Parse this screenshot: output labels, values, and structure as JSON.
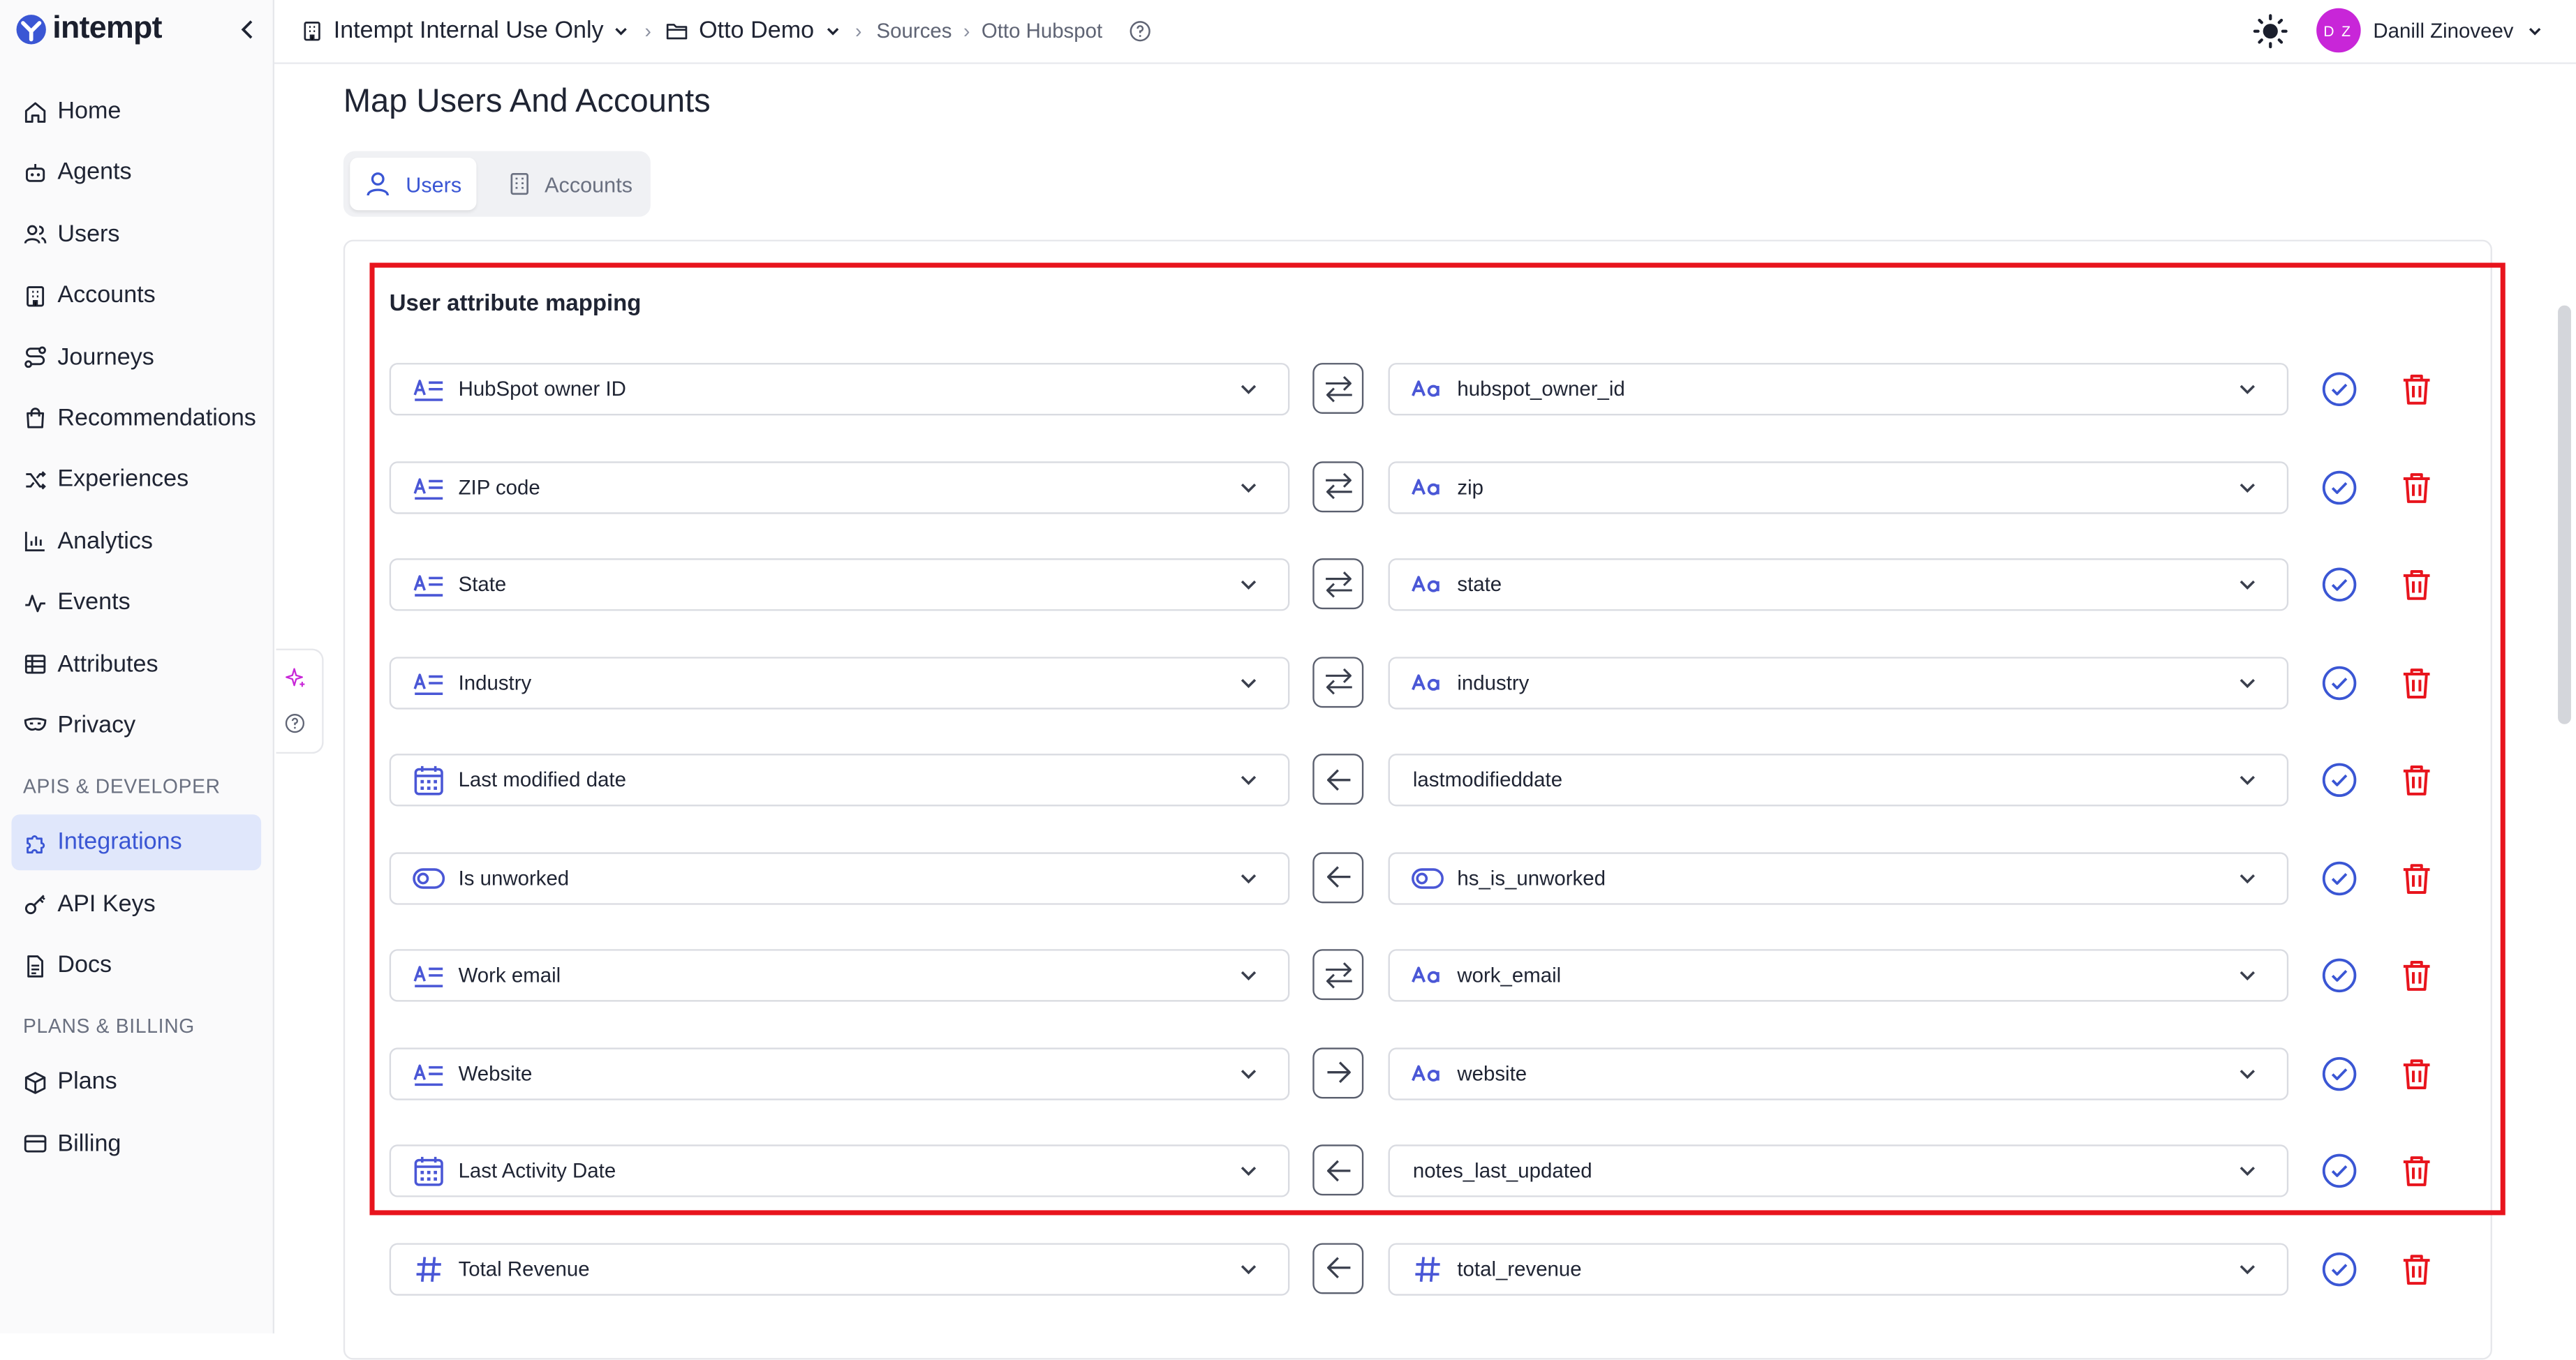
{
  "brand": {
    "name": "intempt"
  },
  "sidebar": {
    "items": [
      {
        "label": "Home",
        "icon": "home-icon"
      },
      {
        "label": "Agents",
        "icon": "agent-icon"
      },
      {
        "label": "Users",
        "icon": "users-icon"
      },
      {
        "label": "Accounts",
        "icon": "building-icon"
      },
      {
        "label": "Journeys",
        "icon": "route-icon"
      },
      {
        "label": "Recommendations",
        "icon": "bag-icon"
      },
      {
        "label": "Experiences",
        "icon": "shuffle-icon"
      },
      {
        "label": "Analytics",
        "icon": "bar-chart-icon"
      },
      {
        "label": "Events",
        "icon": "activity-icon"
      },
      {
        "label": "Attributes",
        "icon": "table-icon"
      }
    ],
    "privacy": {
      "label": "Privacy",
      "icon": "mask-icon"
    },
    "section_dev": "APIS & DEVELOPER",
    "dev_items": [
      {
        "label": "Integrations",
        "icon": "puzzle-icon",
        "active": true
      },
      {
        "label": "API Keys",
        "icon": "key-icon"
      },
      {
        "label": "Docs",
        "icon": "document-icon"
      }
    ],
    "section_billing": "PLANS & BILLING",
    "billing_items": [
      {
        "label": "Plans",
        "icon": "box-icon"
      },
      {
        "label": "Billing",
        "icon": "credit-card-icon"
      }
    ]
  },
  "topbar": {
    "org": "Intempt Internal Use Only",
    "project": "Otto Demo",
    "crumb_sources": "Sources",
    "crumb_current": "Otto Hubspot",
    "user_initials": "D Z",
    "user_name": "Danill Zinoveev"
  },
  "page": {
    "title": "Map Users And Accounts",
    "tabs": [
      {
        "label": "Users",
        "active": true
      },
      {
        "label": "Accounts",
        "active": false
      }
    ],
    "section_title": "User attribute mapping"
  },
  "mappings": [
    {
      "attribute": "HubSpot owner ID",
      "attr_icon": "text-type-icon",
      "direction": "both",
      "source": "hubspot_owner_id",
      "source_icon": "string-type-icon"
    },
    {
      "attribute": "ZIP code",
      "attr_icon": "text-type-icon",
      "direction": "both",
      "source": "zip",
      "source_icon": "string-type-icon"
    },
    {
      "attribute": "State",
      "attr_icon": "text-type-icon",
      "direction": "both",
      "source": "state",
      "source_icon": "string-type-icon"
    },
    {
      "attribute": "Industry",
      "attr_icon": "text-type-icon",
      "direction": "both",
      "source": "industry",
      "source_icon": "string-type-icon"
    },
    {
      "attribute": "Last modified date",
      "attr_icon": "calendar-icon",
      "direction": "left",
      "source": "lastmodifieddate",
      "source_icon": ""
    },
    {
      "attribute": "Is unworked",
      "attr_icon": "toggle-icon",
      "direction": "left",
      "source": "hs_is_unworked",
      "source_icon": "toggle-icon"
    },
    {
      "attribute": "Work email",
      "attr_icon": "text-type-icon",
      "direction": "both",
      "source": "work_email",
      "source_icon": "string-type-icon"
    },
    {
      "attribute": "Website",
      "attr_icon": "text-type-icon",
      "direction": "right",
      "source": "website",
      "source_icon": "string-type-icon"
    },
    {
      "attribute": "Last Activity Date",
      "attr_icon": "calendar-icon",
      "direction": "left",
      "source": "notes_last_updated",
      "source_icon": ""
    },
    {
      "attribute": "Total Revenue",
      "attr_icon": "number-type-icon",
      "direction": "left",
      "source": "total_revenue",
      "source_icon": "number-type-icon"
    }
  ],
  "colors": {
    "accent": "#3a56d4",
    "danger": "#e8141d",
    "highlight": "#e8141d",
    "active_nav_bg": "#e0e7fb",
    "avatar": "#c826d8"
  }
}
